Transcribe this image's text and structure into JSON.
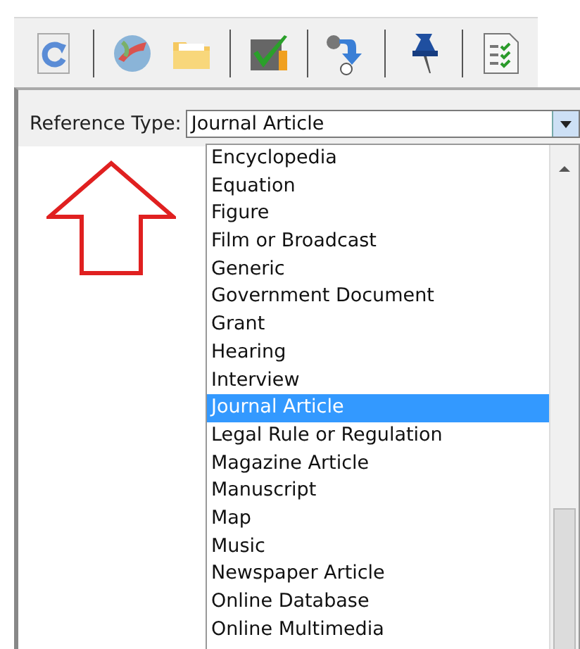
{
  "reference_type": {
    "label": "Reference Type:",
    "value": "Journal Article"
  },
  "dropdown": {
    "items": [
      {
        "label": "Encyclopedia",
        "selected": false
      },
      {
        "label": "Equation",
        "selected": false
      },
      {
        "label": "Figure",
        "selected": false
      },
      {
        "label": "Film or Broadcast",
        "selected": false
      },
      {
        "label": "Generic",
        "selected": false
      },
      {
        "label": "Government Document",
        "selected": false
      },
      {
        "label": "Grant",
        "selected": false
      },
      {
        "label": "Hearing",
        "selected": false
      },
      {
        "label": "Interview",
        "selected": false
      },
      {
        "label": "Journal Article",
        "selected": true
      },
      {
        "label": "Legal Rule or Regulation",
        "selected": false
      },
      {
        "label": "Magazine Article",
        "selected": false
      },
      {
        "label": "Manuscript",
        "selected": false
      },
      {
        "label": "Map",
        "selected": false
      },
      {
        "label": "Music",
        "selected": false
      },
      {
        "label": "Newspaper Article",
        "selected": false
      },
      {
        "label": "Online Database",
        "selected": false
      },
      {
        "label": "Online Multimedia",
        "selected": false
      }
    ]
  }
}
